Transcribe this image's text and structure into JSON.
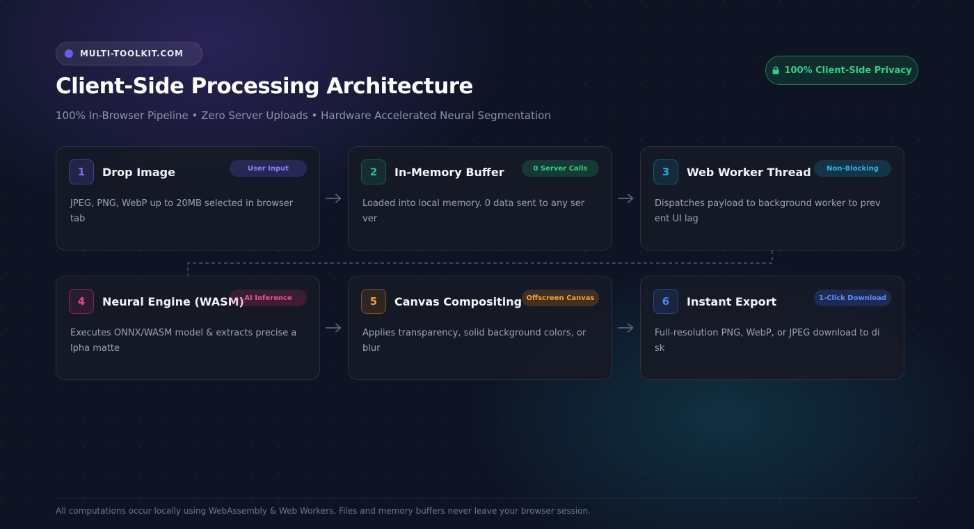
{
  "brand": {
    "label": "MULTI-TOOLKIT.COM",
    "dot_color": "#6d5bf5"
  },
  "header": {
    "title": "Client-Side Processing Architecture",
    "subtitle": "100% In-Browser Pipeline • Zero Server Uploads • Hardware Accelerated Neural Segmentation"
  },
  "privacy_badge": {
    "label": "100% Client-Side Privacy",
    "icon": "lock-icon",
    "color": "#2fd18a"
  },
  "steps": [
    {
      "number": "1",
      "title": "Drop Image",
      "tag": "User Input",
      "accent": "#6d5bf5",
      "description": "JPEG, PNG, WebP up to 20MB selected in browser tab"
    },
    {
      "number": "2",
      "title": "In-Memory Buffer",
      "tag": "0 Server Calls",
      "accent": "#22c489",
      "description": "Loaded into local memory. 0 data sent to any server"
    },
    {
      "number": "3",
      "title": "Web Worker Thread",
      "tag": "Non-Blocking",
      "accent": "#22aed6",
      "description": "Dispatches payload to background worker to prevent UI lag"
    },
    {
      "number": "4",
      "title": "Neural Engine (WASM)",
      "tag": "AI Inference",
      "accent": "#e8478f",
      "description": "Executes ONNX/WASM model & extracts precise alpha matte"
    },
    {
      "number": "5",
      "title": "Canvas Compositing",
      "tag": "Offscreen Canvas",
      "accent": "#f0a02a",
      "description": "Applies transparency, solid background colors, or blur"
    },
    {
      "number": "6",
      "title": "Instant Export",
      "tag": "1-Click Download",
      "accent": "#4f86f2",
      "description": "Full-resolution PNG, WebP, or JPEG download to disk"
    }
  ],
  "footer": {
    "note": "All computations occur locally using WebAssembly & Web Workers. Files and memory buffers never leave your browser session."
  }
}
